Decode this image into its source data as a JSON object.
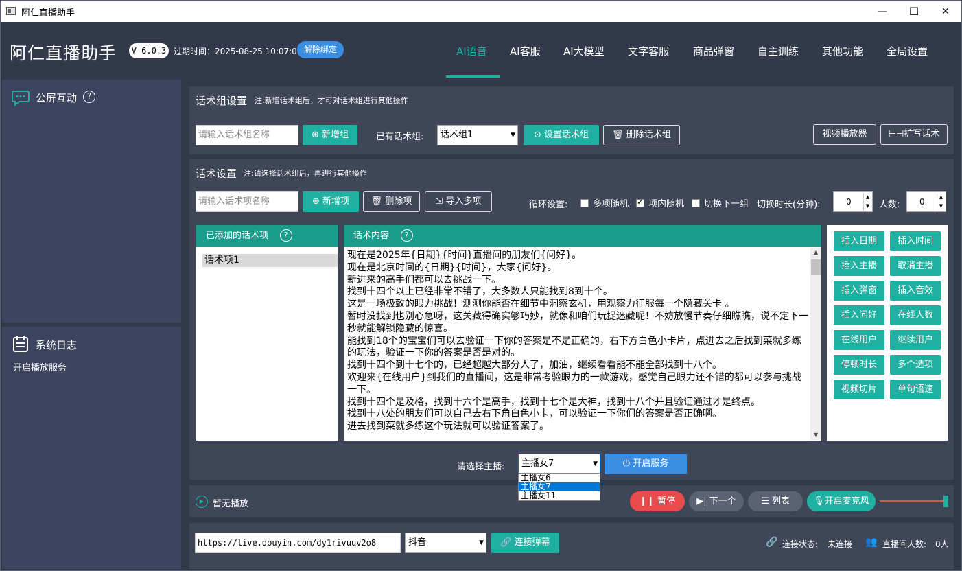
{
  "window": {
    "title": "阿仁直播助手",
    "minimize": "—",
    "maximize": "☐",
    "close": "✕"
  },
  "header": {
    "brand": "阿仁直播助手",
    "version": "V 6.0.3",
    "expire_text": "过期时间：2025-08-25 10:07:00",
    "unbind_label": "解除绑定",
    "nav": [
      "AI语音",
      "AI客服",
      "AI大模型",
      "文字客服",
      "商品弹窗",
      "自主训练",
      "其他功能",
      "全局设置"
    ],
    "active_nav": "AI语音"
  },
  "left": {
    "public_title": "公屏互动",
    "log_title": "系统日志",
    "log_lines": [
      "开启播放服务"
    ]
  },
  "group": {
    "title": "话术组设置",
    "note": "注:新增话术组后，才可对话术组进行其他操作",
    "name_placeholder": "请输入话术组名称",
    "add_label": "新增组",
    "existing_label": "已有话术组:",
    "selected": "话术组1",
    "set_label": "设置话术组",
    "delete_label": "删除话术组",
    "video_player_label": "视频播放器",
    "expand_label": "扩写话术"
  },
  "script": {
    "title": "话术设置",
    "note": "注:请选择话术组后，再进行其他操作",
    "item_placeholder": "请输入话术项名称",
    "add_label": "新增项",
    "delete_label": "删除项",
    "import_label": "导入多项",
    "loop_label": "循环设置:",
    "checks": [
      {
        "label": "多项随机",
        "checked": false
      },
      {
        "label": "项内随机",
        "checked": true
      },
      {
        "label": "切换下一组",
        "checked": false
      }
    ],
    "switch_label": "切换时长(分钟):",
    "switch_value": "0",
    "people_label": "人数:",
    "people_value": "0",
    "added_header": "已添加的话术项",
    "items": [
      "话术项1"
    ],
    "content_header": "话术内容",
    "content_lines": [
      "现在是2025年{日期}{时间}直播间的朋友们{问好}。",
      "现在是北京时间的{日期}{时间}，大家{问好}。",
      "新进来的高手们都可以去挑战一下。",
      "找到十四个以上已经非常不错了，大多数人只能找到8到十个。",
      "这是一场极致的眼力挑战！测测你能否在细节中洞察玄机，用观察力征服每一个隐藏关卡 。",
      "暂时没找到也别心急呀，这关藏得确实够巧妙，就像和咱们玩捉迷藏呢！不妨放慢节奏仔细瞧瞧，说不定下一秒就能解锁隐藏的惊喜。",
      "能找到18个的宝宝们可以去验证一下你的答案是不是正确的，右下方白色小卡片，点进去之后找到菜就多练的玩法，验证一下你的答案是否是对的。",
      "找到十四个到十七个的，已经超越大部分人了，加油，继续看看能不能全部找到十八个。",
      "欢迎来{在线用户}到我们的直播间，这是非常考验眼力的一款游戏，感觉自己眼力还不错的都可以参与挑战一下。",
      "找到十四个是及格，找到十六个是高手，找到十七个是大神，找到十八个并且验证通过才是终点。",
      "找到十八处的朋友们可以自己去右下角白色小卡，可以验证一下你们的答案是否正确啊。",
      "进去找到菜就多练这个玩法就可以验证答案了。"
    ],
    "insert_buttons": [
      "插入日期",
      "插入时间",
      "插入主播",
      "取消主播",
      "插入弹窗",
      "插入音效",
      "插入问好",
      "在线人数",
      "在线用户",
      "继续用户",
      "停顿时长",
      "多个选项",
      "视频切片",
      "单句语速"
    ],
    "anchor_label": "请选择主播:",
    "anchor_selected": "主播女7",
    "anchor_options": [
      "主播女6",
      "主播女7",
      "主播女11"
    ],
    "start_service_label": "开启服务"
  },
  "player": {
    "status": "暂无播放",
    "pause_label": "暂停",
    "next_label": "下一个",
    "list_label": "列表",
    "mic_label": "开启麦克风",
    "volume": 1.0
  },
  "connect": {
    "url": "https://live.douyin.com/dy1rivuuv2o8",
    "platform": "抖音",
    "connect_label": "连接弹幕",
    "status_label": "连接状态:",
    "status_value": "未连接",
    "people_label": "直播间人数:",
    "people_value": "0人"
  },
  "colors": {
    "teal": "#1fb0a1",
    "bg": "#32394a",
    "panel": "#3f4658",
    "pause": "#e84b4b",
    "blue": "#3a8de0"
  }
}
